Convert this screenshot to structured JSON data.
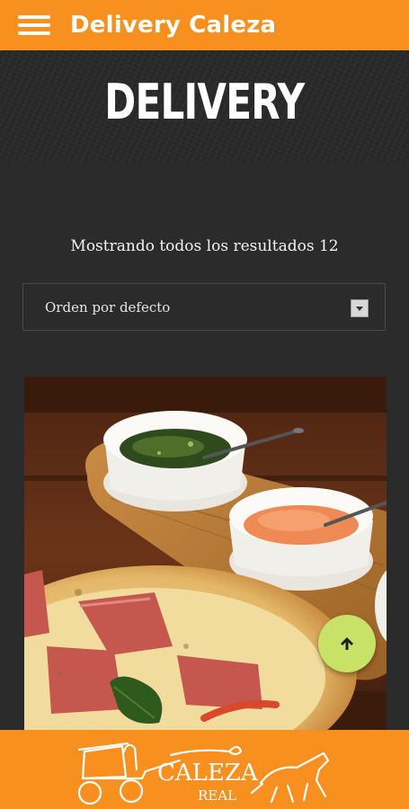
{
  "appbar": {
    "title": "Delivery Caleza",
    "menu_icon": "hamburger-menu-icon"
  },
  "hero": {
    "title": "DELIVERY"
  },
  "results": {
    "text": "Mostrando todos los resultados 12"
  },
  "sort": {
    "selected": "Orden por defecto",
    "arrow_icon": "dropdown-arrow-icon"
  },
  "fab": {
    "icon": "arrow-up-icon"
  },
  "footer": {
    "logo_line1": "CALEZA",
    "logo_line2": "REAL"
  },
  "colors": {
    "accent": "#f7901e",
    "background": "#2b2b2b",
    "fab": "#c7e266"
  }
}
